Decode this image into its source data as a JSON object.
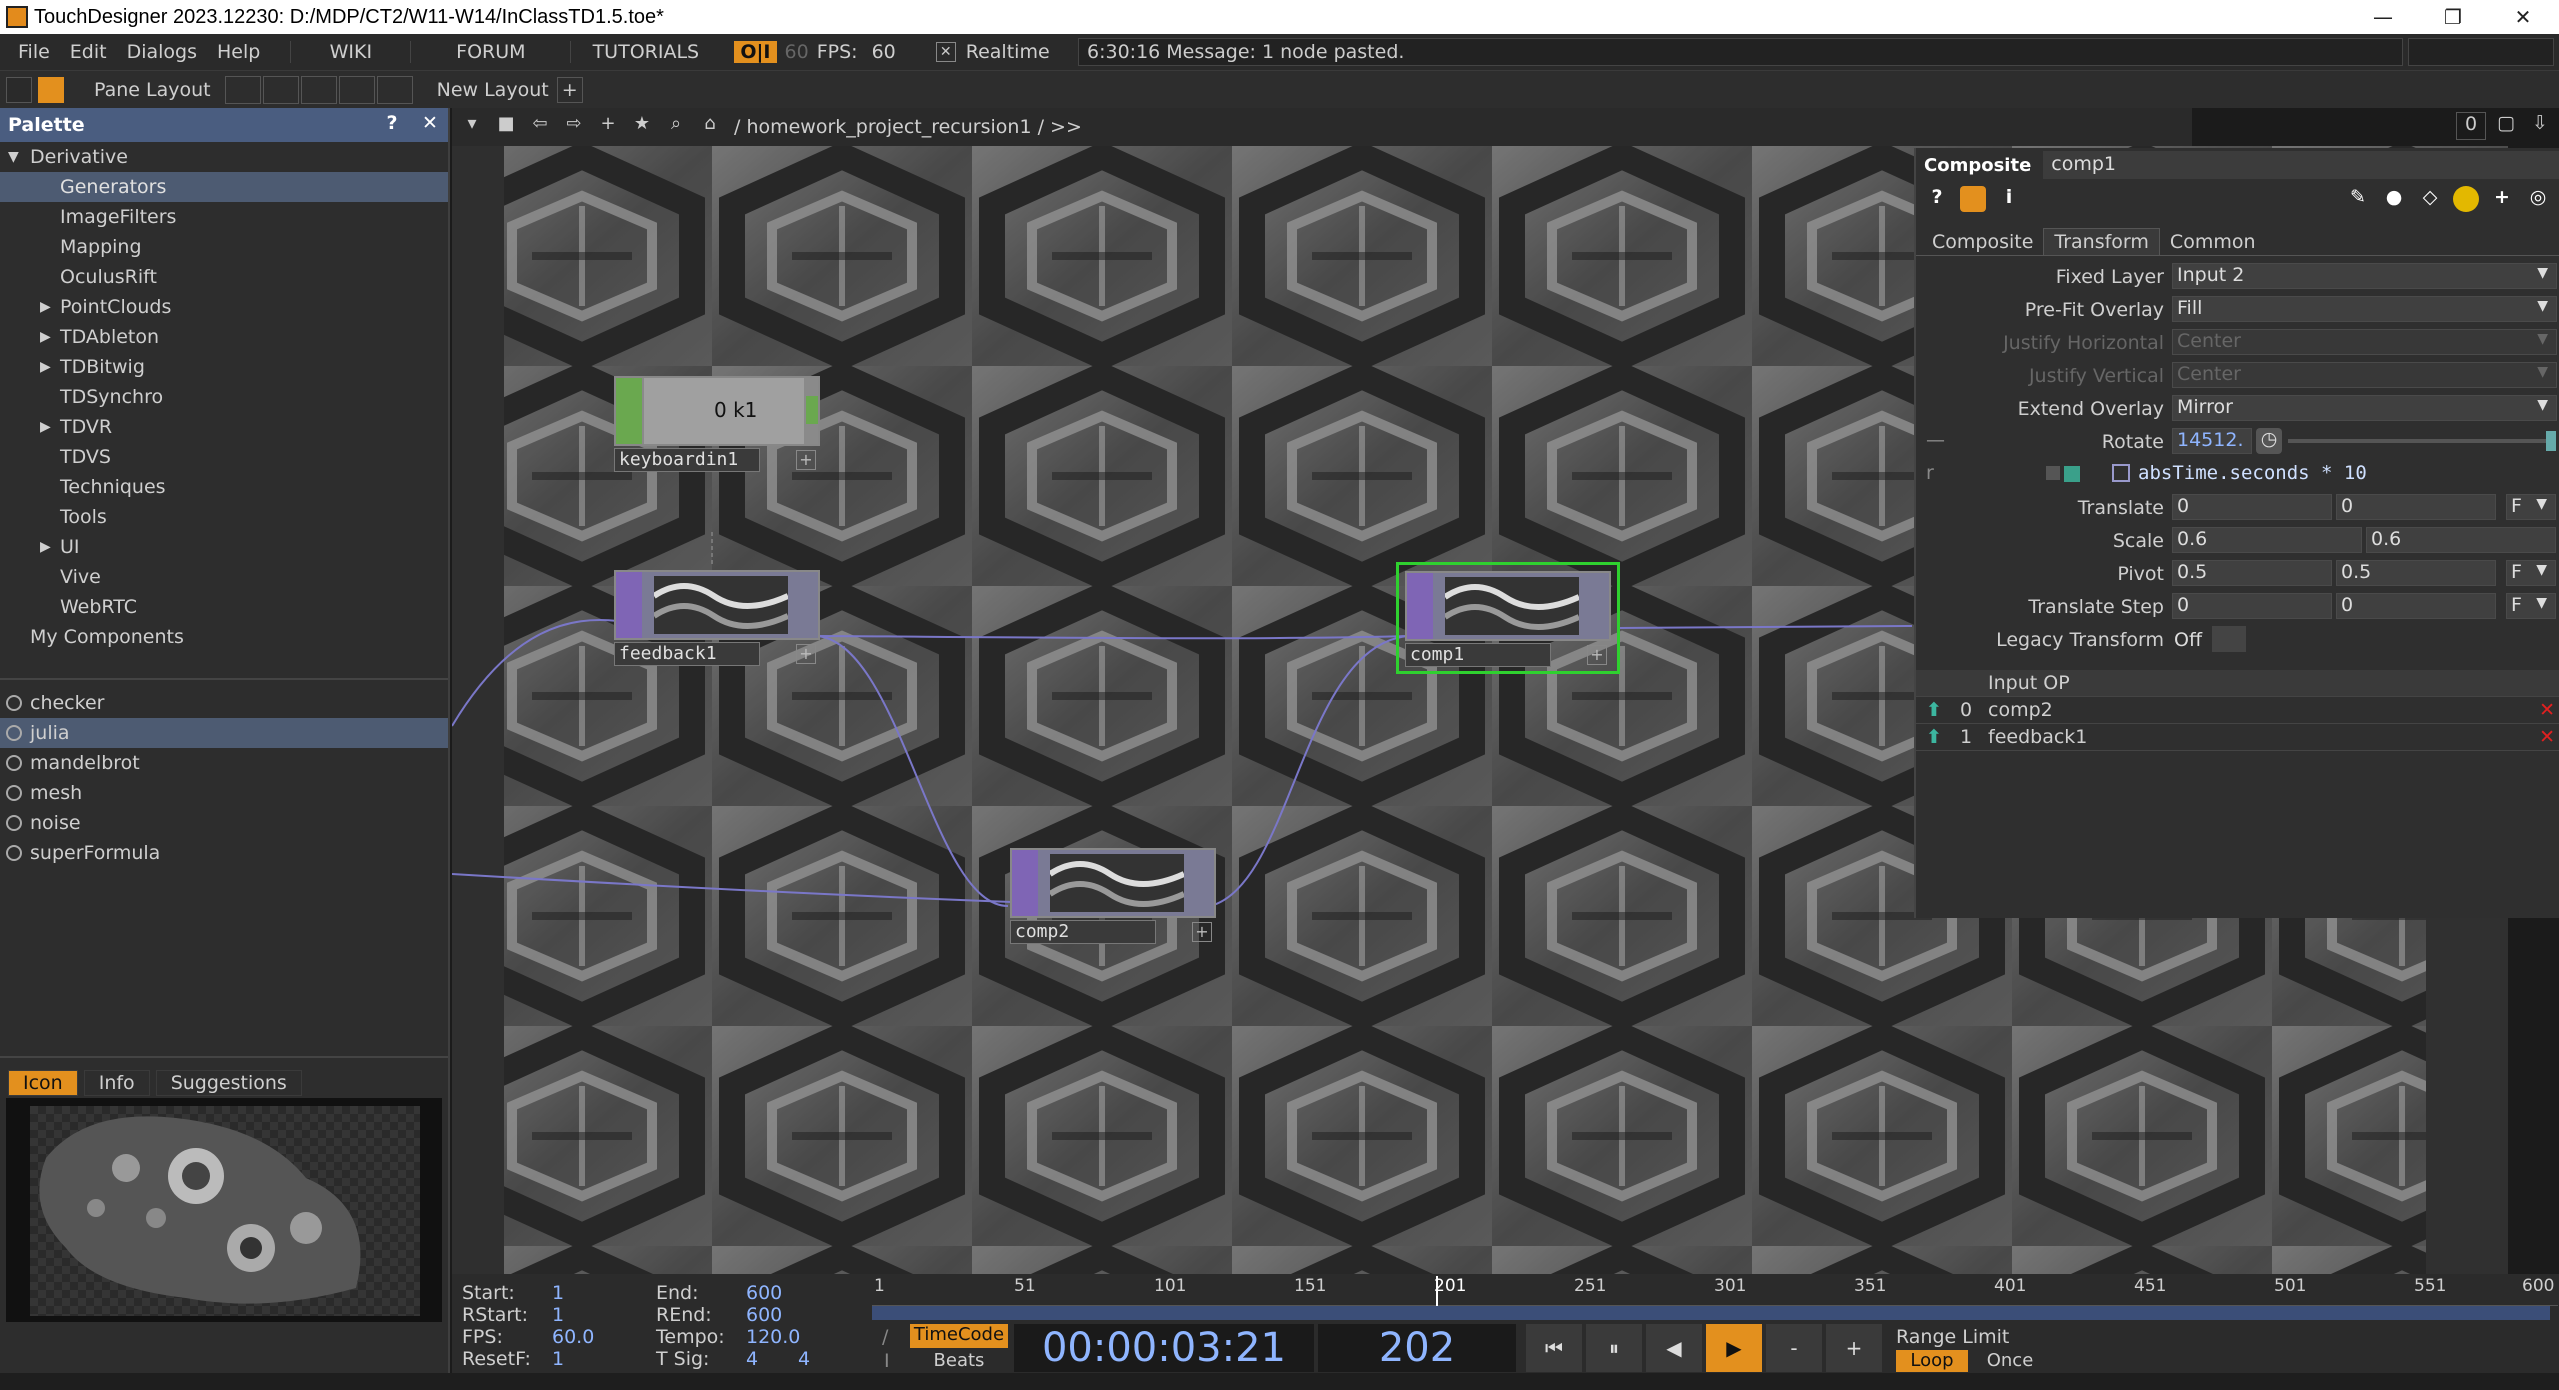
{
  "window": {
    "title": "TouchDesigner 2023.12230: D:/MDP/CT2/W11-W14/InClassTD1.5.toe*",
    "minimize": "—",
    "maximize": "❐",
    "close": "✕"
  },
  "menu": {
    "items": [
      "File",
      "Edit",
      "Dialogs",
      "Help"
    ],
    "links": [
      "WIKI",
      "FORUM",
      "TUTORIALS"
    ],
    "oi": "O|I",
    "fps_cap": "60",
    "fps_label": "FPS:",
    "fps_value": "60",
    "realtime_check": "✕",
    "realtime": "Realtime",
    "message": "6:30:16 Message: 1 node pasted."
  },
  "toolbar2": {
    "pane_layout": "Pane Layout",
    "new_layout": "New Layout",
    "add": "+"
  },
  "palette": {
    "title": "Palette",
    "help": "?",
    "close": "✕",
    "root": "Derivative",
    "items": [
      {
        "label": "Generators",
        "expand": "",
        "selected": true
      },
      {
        "label": "ImageFilters",
        "expand": ""
      },
      {
        "label": "Mapping",
        "expand": ""
      },
      {
        "label": "OculusRift",
        "expand": ""
      },
      {
        "label": "PointClouds",
        "expand": "▶"
      },
      {
        "label": "TDAbleton",
        "expand": "▶"
      },
      {
        "label": "TDBitwig",
        "expand": "▶"
      },
      {
        "label": "TDSynchro",
        "expand": ""
      },
      {
        "label": "TDVR",
        "expand": "▶"
      },
      {
        "label": "TDVS",
        "expand": ""
      },
      {
        "label": "Techniques",
        "expand": ""
      },
      {
        "label": "Tools",
        "expand": ""
      },
      {
        "label": "UI",
        "expand": "▶"
      },
      {
        "label": "Vive",
        "expand": ""
      },
      {
        "label": "WebRTC",
        "expand": ""
      }
    ],
    "my_components": "My Components",
    "components": [
      "checker",
      "julia",
      "mandelbrot",
      "mesh",
      "noise",
      "superFormula"
    ],
    "selected_component": "julia",
    "tabs": [
      "Icon",
      "Info",
      "Suggestions"
    ]
  },
  "network": {
    "path": "/ homework_project_recursion1 / >>",
    "counter": "0",
    "nodes": {
      "keyboard": {
        "name": "keyboardin1",
        "value": "0 k1"
      },
      "feedback": {
        "name": "feedback1"
      },
      "comp1": {
        "name": "comp1"
      },
      "comp2": {
        "name": "comp2"
      }
    }
  },
  "params": {
    "type": "Composite",
    "name": "comp1",
    "tabs": [
      "Composite",
      "Transform",
      "Common"
    ],
    "active_tab": "Transform",
    "rows": {
      "fixed_layer": {
        "label": "Fixed Layer",
        "value": "Input 2"
      },
      "prefit": {
        "label": "Pre-Fit Overlay",
        "value": "Fill"
      },
      "justify_h": {
        "label": "Justify Horizontal",
        "value": "Center"
      },
      "justify_v": {
        "label": "Justify Vertical",
        "value": "Center"
      },
      "extend": {
        "label": "Extend Overlay",
        "value": "Mirror"
      },
      "rotate": {
        "label": "Rotate",
        "value": "14512."
      },
      "expr": {
        "value": "absTime.seconds * 10"
      },
      "translate": {
        "label": "Translate",
        "x": "0",
        "y": "0",
        "unit": "F"
      },
      "scale": {
        "label": "Scale",
        "x": "0.6",
        "y": "0.6"
      },
      "pivot": {
        "label": "Pivot",
        "x": "0.5",
        "y": "0.5",
        "unit": "F"
      },
      "translate_step": {
        "label": "Translate Step",
        "x": "0",
        "y": "0",
        "unit": "F"
      },
      "legacy": {
        "label": "Legacy Transform",
        "value": "Off"
      }
    },
    "input_op_header": "Input OP",
    "inputs": [
      {
        "index": "0",
        "name": "comp2"
      },
      {
        "index": "1",
        "name": "feedback1"
      }
    ]
  },
  "timeline": {
    "labels": {
      "start": "Start:",
      "start_v": "1",
      "rstart": "RStart:",
      "rstart_v": "1",
      "fps": "FPS:",
      "fps_v": "60.0",
      "resetf": "ResetF:",
      "resetf_v": "1",
      "end": "End:",
      "end_v": "600",
      "rend": "REnd:",
      "rend_v": "600",
      "tempo": "Tempo:",
      "tempo_v": "120.0",
      "tsig": "T Sig:",
      "tsig_a": "4",
      "tsig_b": "4"
    },
    "ticks": [
      "1",
      "51",
      "101",
      "151",
      "201",
      "251",
      "301",
      "351",
      "401",
      "451",
      "501",
      "551",
      "600"
    ],
    "timecode_btn": "TimeCode",
    "beats_btn": "Beats",
    "timecode": "00:00:03:21",
    "frame": "202",
    "controls": [
      "⏮",
      "⏸",
      "◀",
      "▶",
      "-",
      "+"
    ],
    "range_limit": "Range Limit",
    "loop": "Loop",
    "once": "Once"
  }
}
